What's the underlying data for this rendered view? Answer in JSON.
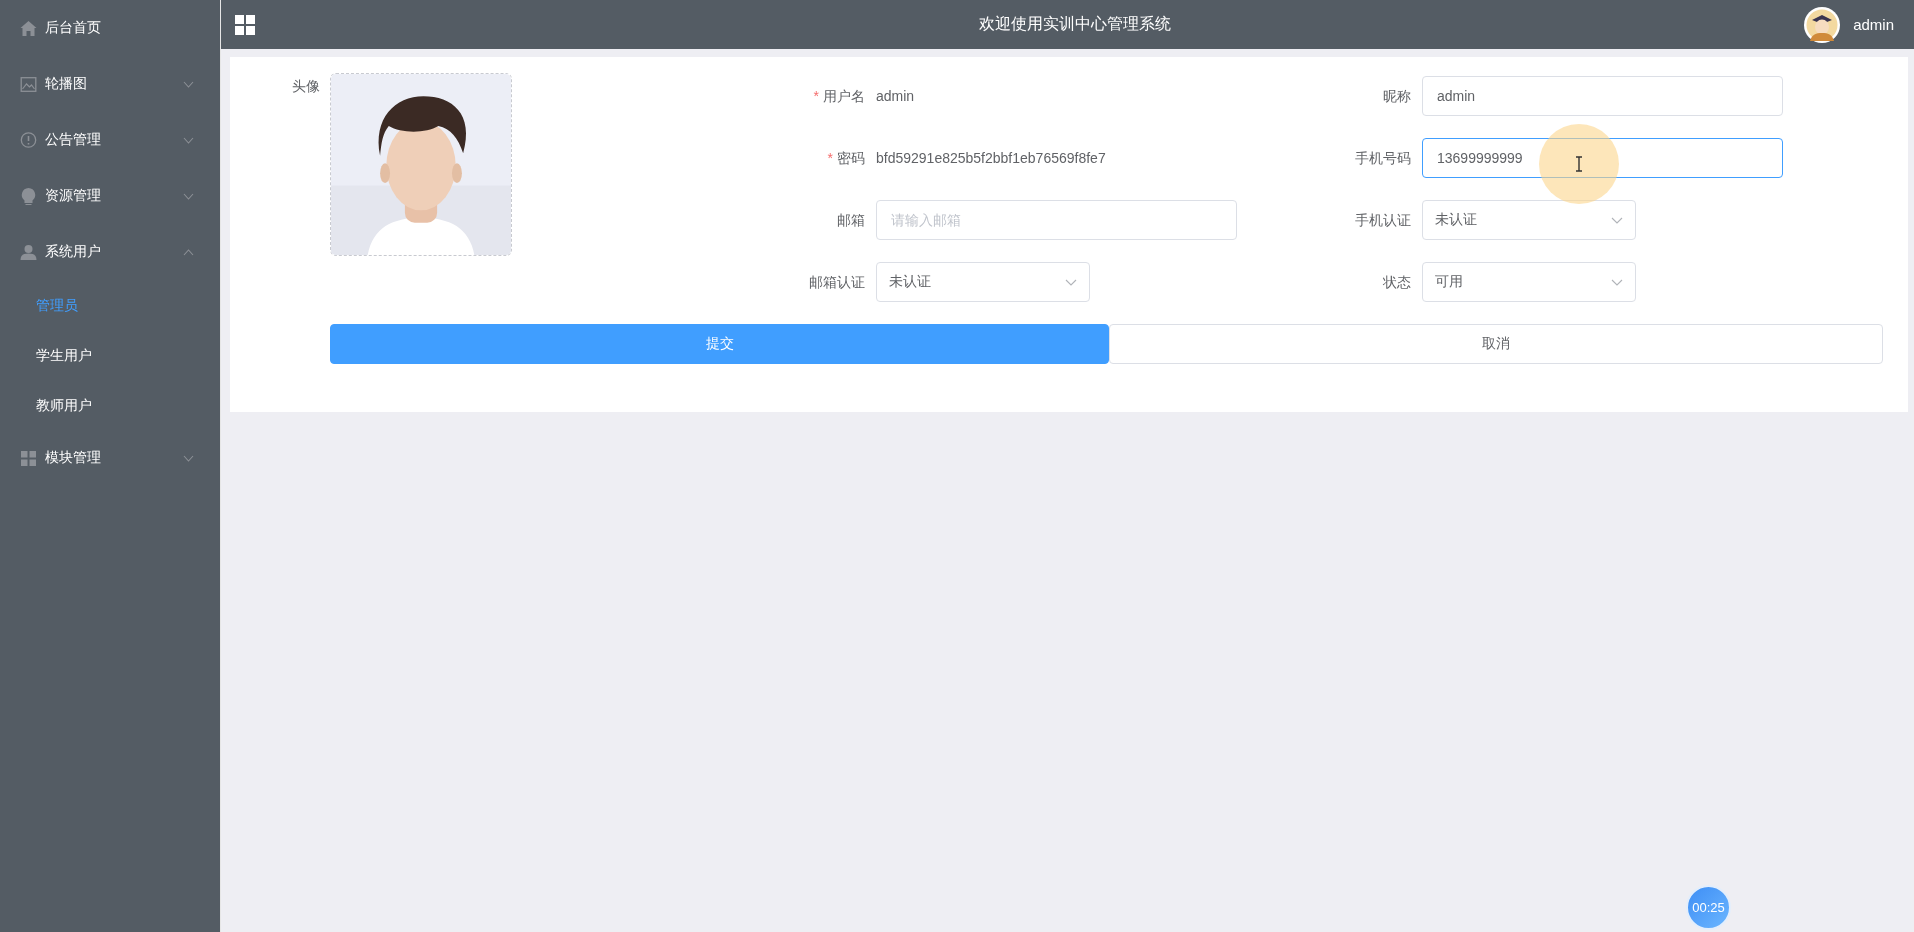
{
  "header": {
    "title": "欢迎使用实训中心管理系统",
    "user": "admin"
  },
  "sidebar": {
    "items": [
      {
        "label": "后台首页",
        "kind": "link"
      },
      {
        "label": "轮播图",
        "kind": "submenu",
        "expanded": false
      },
      {
        "label": "公告管理",
        "kind": "submenu",
        "expanded": false
      },
      {
        "label": "资源管理",
        "kind": "submenu",
        "expanded": false
      },
      {
        "label": "系统用户",
        "kind": "submenu",
        "expanded": true,
        "children": [
          {
            "label": "管理员",
            "selected": true
          },
          {
            "label": "学生用户",
            "selected": false
          },
          {
            "label": "教师用户",
            "selected": false
          }
        ]
      },
      {
        "label": "模块管理",
        "kind": "submenu",
        "expanded": false
      }
    ]
  },
  "form": {
    "avatar": {
      "label": "头像",
      "kind": "picture"
    },
    "rows": [
      [
        {
          "required_mark": "*",
          "label": "用户名",
          "kind": "text",
          "value": "admin"
        },
        {
          "label": "昵称",
          "kind": "input",
          "value": "admin",
          "focused": false
        }
      ],
      [
        {
          "required_mark": "*",
          "label": "密码",
          "kind": "text",
          "value": "bfd59291e825b5f2bbf1eb76569f8fe7"
        },
        {
          "label": "手机号码",
          "kind": "input",
          "value": "13699999999",
          "focused": true
        }
      ],
      [
        {
          "label": "邮箱",
          "kind": "input",
          "placeholder": "请输入邮箱",
          "focused": false
        },
        {
          "label": "手机认证",
          "kind": "select",
          "value": "未认证"
        }
      ],
      [
        {
          "label": "邮箱认证",
          "kind": "select",
          "value": "未认证"
        },
        {
          "label": "状态",
          "kind": "select",
          "value": "可用"
        }
      ]
    ],
    "buttons": [
      {
        "label": "提交",
        "kind": "primary"
      },
      {
        "label": "取消",
        "kind": "default"
      }
    ]
  },
  "recording_timer": "00:25"
}
